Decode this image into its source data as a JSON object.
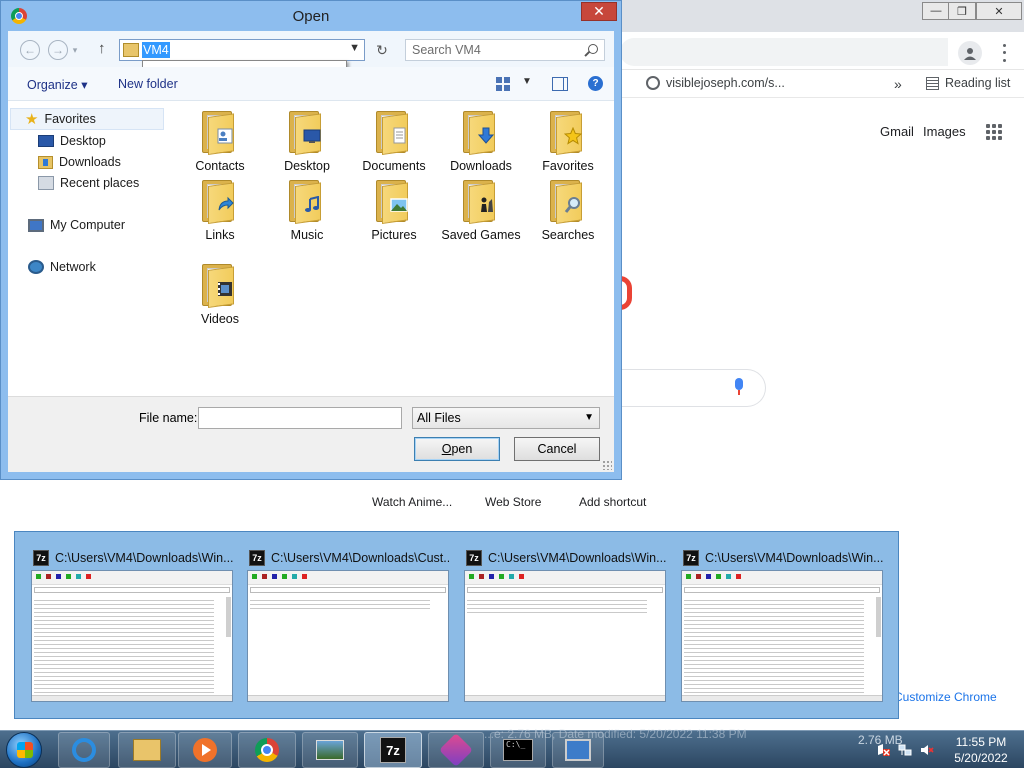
{
  "dialog": {
    "title": "Open",
    "address": "VM4",
    "search_placeholder": "Search VM4",
    "organize_label": "Organize",
    "new_folder_label": "New folder",
    "nav": [
      {
        "label": "Favorites",
        "icon": "star-icon"
      },
      {
        "label": "Desktop",
        "icon": "desktop-icon"
      },
      {
        "label": "Downloads",
        "icon": "downloads-icon"
      },
      {
        "label": "Recent places",
        "icon": "recent-places-icon"
      },
      {
        "label": "My Computer",
        "icon": "computer-icon"
      },
      {
        "label": "Network",
        "icon": "network-icon"
      }
    ],
    "folders": [
      {
        "label": "Contacts",
        "icon": "contacts-folder-icon"
      },
      {
        "label": "Desktop",
        "icon": "desktop-folder-icon"
      },
      {
        "label": "Documents",
        "icon": "documents-folder-icon"
      },
      {
        "label": "Downloads",
        "icon": "downloads-folder-icon"
      },
      {
        "label": "Favorites",
        "icon": "favorites-folder-icon"
      },
      {
        "label": "Links",
        "icon": "links-folder-icon"
      },
      {
        "label": "Music",
        "icon": "music-folder-icon"
      },
      {
        "label": "Pictures",
        "icon": "pictures-folder-icon"
      },
      {
        "label": "Saved Games",
        "icon": "saved-games-folder-icon"
      },
      {
        "label": "Searches",
        "icon": "searches-folder-icon"
      },
      {
        "label": "Videos",
        "icon": "videos-folder-icon"
      }
    ],
    "file_name_label": "File name:",
    "file_name_value": "",
    "file_type": "All Files",
    "open_label_accel": "O",
    "open_label_rest": "pen",
    "cancel_label": "Cancel"
  },
  "chrome": {
    "bookmark_site": "visiblejoseph.com/s...",
    "overflow": "»",
    "reading_list": "Reading list",
    "gmail": "Gmail",
    "images": "Images",
    "shortcuts": [
      "Watch Anime...",
      "Web Store",
      "Add shortcut"
    ],
    "customize": "Customize Chrome"
  },
  "flyout": {
    "thumbnails": [
      {
        "title": "C:\\Users\\VM4\\Downloads\\Win..."
      },
      {
        "title": "C:\\Users\\VM4\\Downloads\\Cust..."
      },
      {
        "title": "C:\\Users\\VM4\\Downloads\\Win..."
      },
      {
        "title": "C:\\Users\\VM4\\Downloads\\Win..."
      }
    ]
  },
  "taskbar": {
    "tray_size": "2.76 MB",
    "time": "11:55 PM",
    "date": "5/20/2022",
    "ghost_status": "...e: 2.76 MB, Date modified: 5/20/2022 11:38 PM"
  }
}
